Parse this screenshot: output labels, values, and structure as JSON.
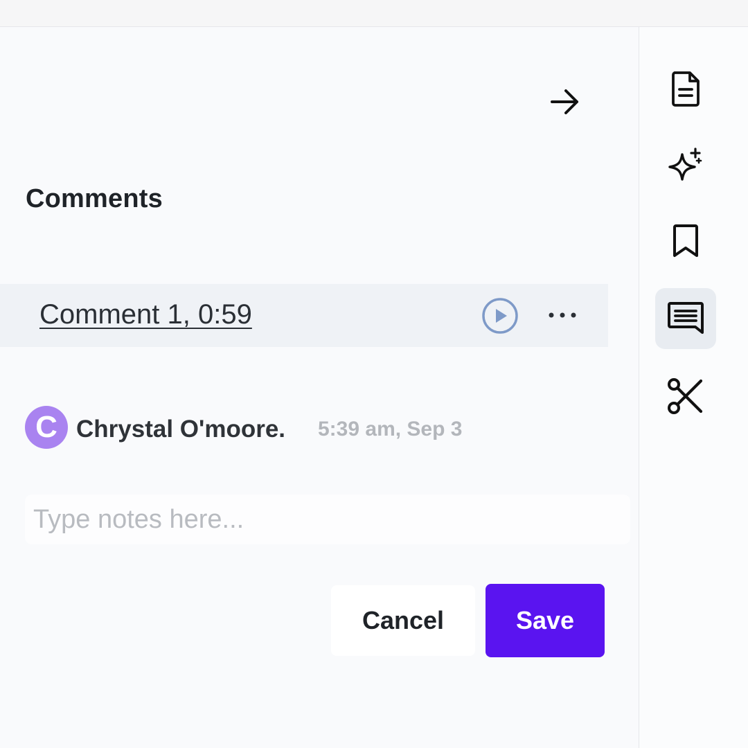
{
  "panel": {
    "title": "Comments",
    "collapse_icon": "arrow-right-icon"
  },
  "comment": {
    "link_label": "Comment 1, 0:59",
    "play_icon": "play-circle-icon",
    "more_icon": "more-horizontal-icon",
    "more_label": "···"
  },
  "author": {
    "avatar_initial": "C",
    "avatar_color": "#a983f0",
    "name": "Chrystal O'moore.",
    "timestamp": "5:39 am, Sep 3"
  },
  "notes": {
    "placeholder": "Type notes here...",
    "value": ""
  },
  "actions": {
    "cancel_label": "Cancel",
    "save_label": "Save",
    "save_color": "#5a14f0"
  },
  "rail": {
    "items": [
      {
        "icon": "document-icon",
        "active": false
      },
      {
        "icon": "sparkles-icon",
        "active": false
      },
      {
        "icon": "bookmark-icon",
        "active": false
      },
      {
        "icon": "comment-icon",
        "active": true
      },
      {
        "icon": "scissors-icon",
        "active": false
      }
    ]
  }
}
